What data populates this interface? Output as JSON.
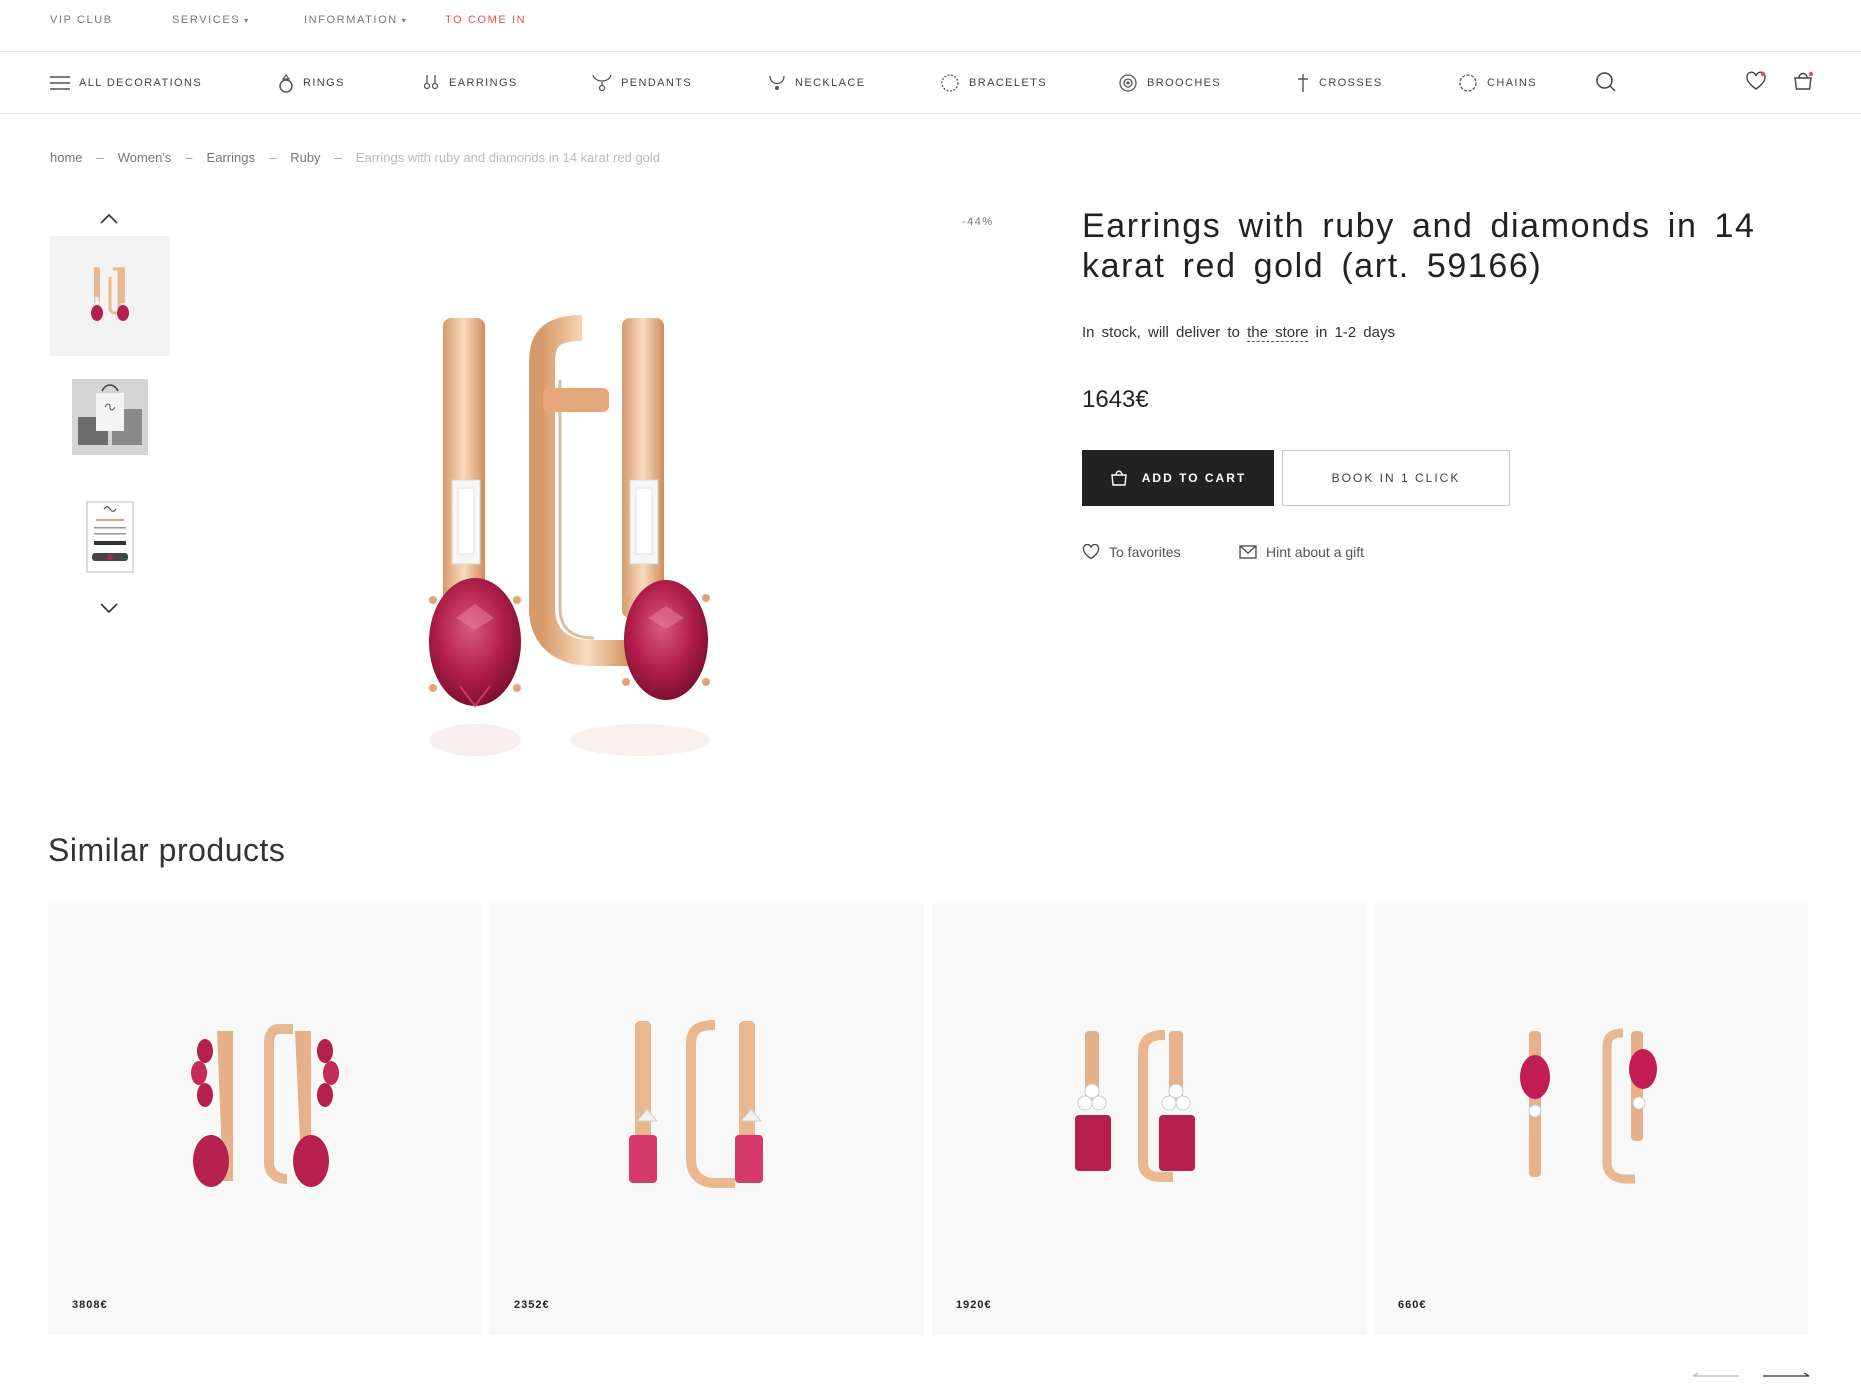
{
  "topbar": {
    "vip": "VIP CLUB",
    "services": "SERVICES",
    "information": "INFORMATION",
    "login": "TO COME IN"
  },
  "nav": {
    "all": "ALL DECORATIONS",
    "rings": "RINGS",
    "earrings": "EARRINGS",
    "pendants": "PENDANTS",
    "necklace": "NECKLACE",
    "bracelets": "BRACELETS",
    "brooches": "BROOCHES",
    "crosses": "CROSSES",
    "chains": "CHAINS"
  },
  "breadcrumb": {
    "home": "home",
    "women": "Women's",
    "earrings": "Earrings",
    "ruby": "Ruby",
    "current": "Earrings with ruby and diamonds in 14 karat red gold",
    "separator": "–"
  },
  "product": {
    "discount": "-44%",
    "title": "Earrings with ruby and diamonds in 14 karat red gold (art. 59166)",
    "stock_pre": "In stock, will deliver to ",
    "stock_store": "the store",
    "stock_post": " in 1-2 days",
    "price": "1643€",
    "add_to_cart": "ADD TO CART",
    "book": "BOOK IN 1 CLICK",
    "favorites": "To favorites",
    "hint": "Hint about a gift"
  },
  "similar": {
    "title": "Similar products",
    "items": [
      {
        "price": "3808€"
      },
      {
        "price": "2352€"
      },
      {
        "price": "1920€"
      },
      {
        "price": "660€"
      }
    ]
  },
  "colors": {
    "accent_red": "#e8524b",
    "dark_button": "#222222",
    "ruby": "#b5204f",
    "gold": "#e9b88e"
  }
}
